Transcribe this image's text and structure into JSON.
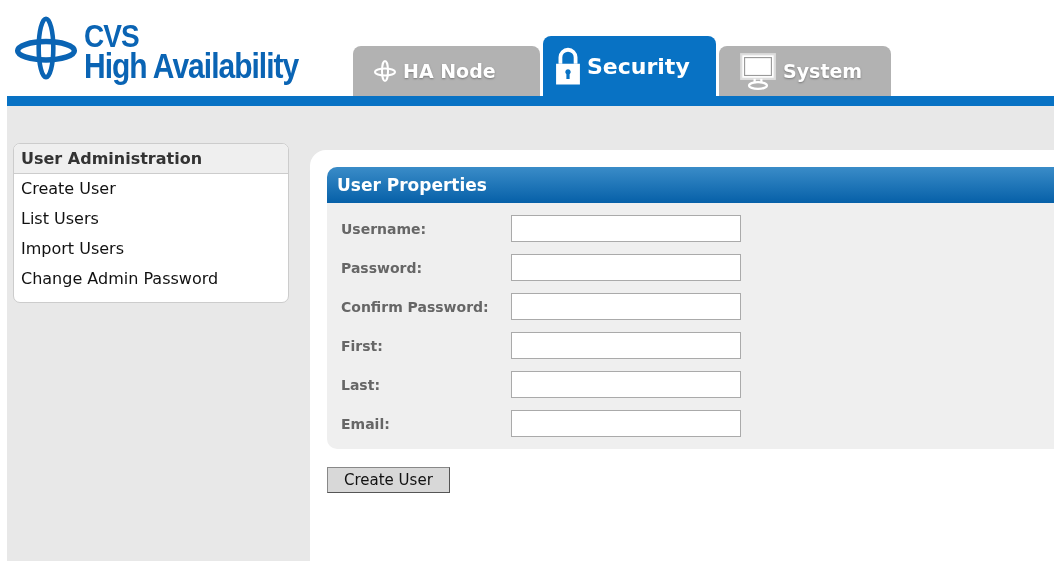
{
  "logo": {
    "line_1": "CVS",
    "line_2": "High Availability"
  },
  "tabs": [
    {
      "label": "HA Node",
      "kind": "node",
      "selected": false
    },
    {
      "label": "Security",
      "kind": "lock",
      "selected": true
    },
    {
      "label": "System",
      "kind": "monitor",
      "selected": false
    }
  ],
  "sidebar": {
    "title": "User Administration",
    "items": [
      "Create User",
      "List Users",
      "Import Users",
      "Change Admin Password"
    ]
  },
  "form": {
    "title": "User Properties",
    "fields": [
      {
        "label": "Username:"
      },
      {
        "label": "Password:"
      },
      {
        "label": "Confirm Password:"
      },
      {
        "label": "First:"
      },
      {
        "label": "Last:"
      },
      {
        "label": "Email:"
      }
    ],
    "submit": "Create User"
  }
}
